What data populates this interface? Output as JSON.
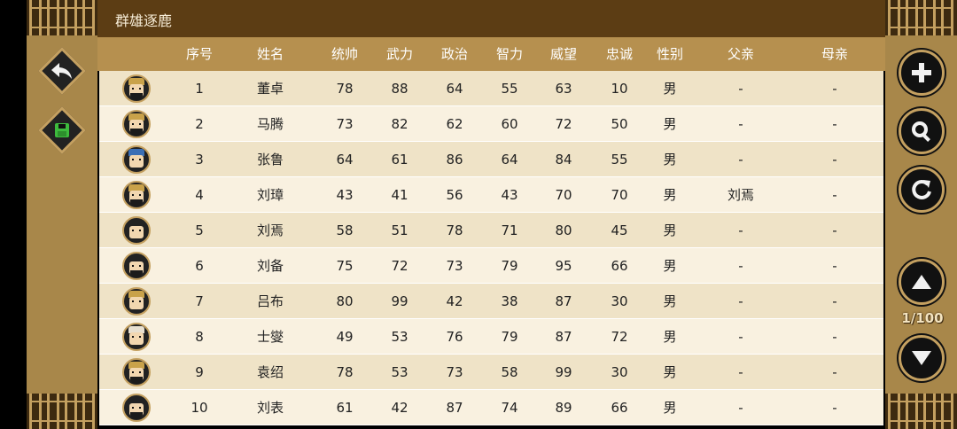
{
  "title": "群雄逐鹿",
  "headers": {
    "index": "序号",
    "name": "姓名",
    "command": "统帅",
    "force": "武力",
    "politics": "政治",
    "intelligence": "智力",
    "prestige": "威望",
    "loyalty": "忠诚",
    "gender": "性别",
    "father": "父亲",
    "mother": "母亲"
  },
  "rows": [
    {
      "index": "1",
      "name": "董卓",
      "command": "78",
      "force": "88",
      "politics": "64",
      "intelligence": "55",
      "prestige": "63",
      "loyalty": "10",
      "gender": "男",
      "father": "-",
      "mother": "-",
      "hat_color": "#c9a24a",
      "beard": true
    },
    {
      "index": "2",
      "name": "马腾",
      "command": "73",
      "force": "82",
      "politics": "62",
      "intelligence": "60",
      "prestige": "72",
      "loyalty": "50",
      "gender": "男",
      "father": "-",
      "mother": "-",
      "hat_color": "#c9a24a",
      "beard": true
    },
    {
      "index": "3",
      "name": "张鲁",
      "command": "64",
      "force": "61",
      "politics": "86",
      "intelligence": "64",
      "prestige": "84",
      "loyalty": "55",
      "gender": "男",
      "father": "-",
      "mother": "-",
      "hat_color": "#3b6fb5",
      "beard": false
    },
    {
      "index": "4",
      "name": "刘璋",
      "command": "43",
      "force": "41",
      "politics": "56",
      "intelligence": "43",
      "prestige": "70",
      "loyalty": "70",
      "gender": "男",
      "father": "刘焉",
      "mother": "-",
      "hat_color": "#c9a24a",
      "beard": true
    },
    {
      "index": "5",
      "name": "刘焉",
      "command": "58",
      "force": "51",
      "politics": "78",
      "intelligence": "71",
      "prestige": "80",
      "loyalty": "45",
      "gender": "男",
      "father": "-",
      "mother": "-",
      "hat_color": "#222222",
      "beard": false
    },
    {
      "index": "6",
      "name": "刘备",
      "command": "75",
      "force": "72",
      "politics": "73",
      "intelligence": "79",
      "prestige": "95",
      "loyalty": "66",
      "gender": "男",
      "father": "-",
      "mother": "-",
      "hat_color": "#222222",
      "beard": true
    },
    {
      "index": "7",
      "name": "吕布",
      "command": "80",
      "force": "99",
      "politics": "42",
      "intelligence": "38",
      "prestige": "87",
      "loyalty": "30",
      "gender": "男",
      "father": "-",
      "mother": "-",
      "hat_color": "#c9a24a",
      "beard": false
    },
    {
      "index": "8",
      "name": "士燮",
      "command": "49",
      "force": "53",
      "politics": "76",
      "intelligence": "79",
      "prestige": "87",
      "loyalty": "72",
      "gender": "男",
      "father": "-",
      "mother": "-",
      "hat_color": "#e8e0d0",
      "beard": false
    },
    {
      "index": "9",
      "name": "袁绍",
      "command": "78",
      "force": "53",
      "politics": "73",
      "intelligence": "58",
      "prestige": "99",
      "loyalty": "30",
      "gender": "男",
      "father": "-",
      "mother": "-",
      "hat_color": "#c9a24a",
      "beard": true
    },
    {
      "index": "10",
      "name": "刘表",
      "command": "61",
      "force": "42",
      "politics": "87",
      "intelligence": "74",
      "prestige": "89",
      "loyalty": "66",
      "gender": "男",
      "father": "-",
      "mother": "-",
      "hat_color": "#222222",
      "beard": true
    }
  ],
  "pagination": {
    "indicator": "1/100"
  },
  "icons": {
    "back": "undo-arrow-icon",
    "save": "save-icon",
    "add": "plus-icon",
    "search": "search-icon",
    "refresh": "refresh-icon",
    "page_up": "triangle-up-icon",
    "page_down": "triangle-down-icon"
  },
  "colors": {
    "title_bar": "#5c3d14",
    "header": "#b6904f",
    "row_odd": "#efe3c7",
    "row_even": "#f9f1e0",
    "panel": "#a8874a",
    "save_green": "#3dbb3d"
  }
}
